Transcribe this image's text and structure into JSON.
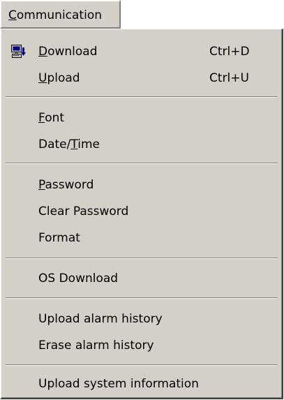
{
  "menu_bar": {
    "title": "Communication",
    "title_mnemonic": "C",
    "title_rest": "ommunication"
  },
  "menu": {
    "groups": [
      [
        {
          "label": "Download",
          "mnemonic": "D",
          "rest": "ownload",
          "shortcut": "Ctrl+D",
          "icon": "download-computer-icon"
        },
        {
          "label": "Upload",
          "mnemonic": "U",
          "rest": "pload",
          "shortcut": "Ctrl+U"
        }
      ],
      [
        {
          "label": "Font",
          "mnemonic": "F",
          "rest": "ont"
        },
        {
          "label": "Date/Time",
          "pre": "Date/",
          "mnemonic": "T",
          "rest": "ime"
        }
      ],
      [
        {
          "label": "Password",
          "mnemonic": "P",
          "rest": "assword"
        },
        {
          "label": "Clear Password"
        },
        {
          "label": "Format"
        }
      ],
      [
        {
          "label": "OS Download"
        }
      ],
      [
        {
          "label": "Upload alarm history"
        },
        {
          "label": "Erase alarm history"
        }
      ],
      [
        {
          "label": "Upload system information"
        }
      ]
    ]
  },
  "colors": {
    "menu_background": "#d4d0c8",
    "text": "#000000",
    "separator_dark": "#808080",
    "separator_light": "#ffffff"
  }
}
